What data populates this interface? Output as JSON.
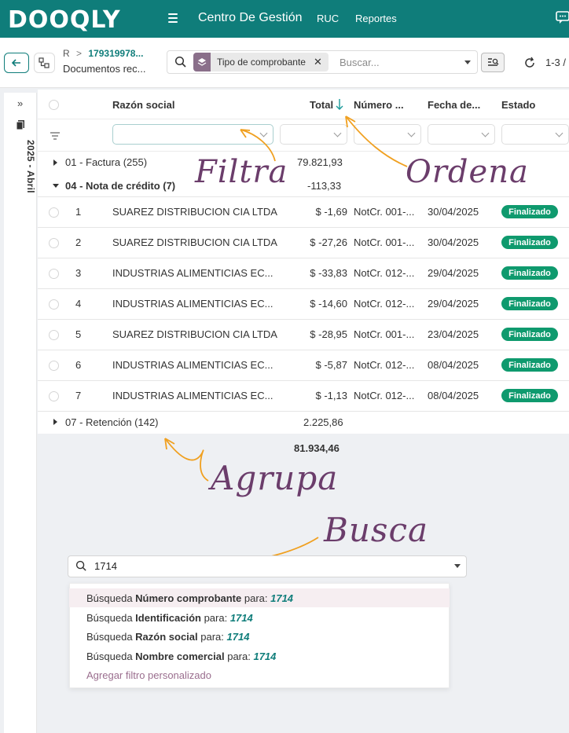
{
  "brand": {
    "logo_text": "DOOQLY",
    "accent": "#0f7d7a"
  },
  "topnav": {
    "title": "Centro De Gestión",
    "links": [
      "RUC",
      "Reportes"
    ]
  },
  "breadcrumb": {
    "prefix": "R",
    "separator": ">",
    "link": "179319978...",
    "current": "Documentos rec..."
  },
  "search": {
    "facet_label": "Tipo de comprobante",
    "placeholder": "Buscar...",
    "pager": "1-3 /"
  },
  "side": {
    "label": "2025 - Abril"
  },
  "columns": {
    "razon": "Razón social",
    "total": "Total",
    "numero": "Número ...",
    "fecha": "Fecha de...",
    "estado": "Estado"
  },
  "groups": [
    {
      "label": "01 - Factura (255)",
      "total": "79.821,93"
    },
    {
      "label": "04 - Nota de crédito (7)",
      "total": "-113,33"
    },
    {
      "label": "07 - Retención (142)",
      "total": "2.225,86"
    }
  ],
  "rows": [
    {
      "n": "1",
      "razon": "SUAREZ DISTRIBUCION CIA LTDA",
      "total": "$ -1,69",
      "numero": "NotCr. 001-...",
      "fecha": "30/04/2025",
      "estado": "Finalizado"
    },
    {
      "n": "2",
      "razon": "SUAREZ DISTRIBUCION CIA LTDA",
      "total": "$ -27,26",
      "numero": "NotCr. 001-...",
      "fecha": "30/04/2025",
      "estado": "Finalizado"
    },
    {
      "n": "3",
      "razon": "INDUSTRIAS ALIMENTICIAS EC...",
      "total": "$ -33,83",
      "numero": "NotCr. 012-...",
      "fecha": "29/04/2025",
      "estado": "Finalizado"
    },
    {
      "n": "4",
      "razon": "INDUSTRIAS ALIMENTICIAS EC...",
      "total": "$ -14,60",
      "numero": "NotCr. 012-...",
      "fecha": "29/04/2025",
      "estado": "Finalizado"
    },
    {
      "n": "5",
      "razon": "SUAREZ DISTRIBUCION CIA LTDA",
      "total": "$ -28,95",
      "numero": "NotCr. 001-...",
      "fecha": "23/04/2025",
      "estado": "Finalizado"
    },
    {
      "n": "6",
      "razon": "INDUSTRIAS ALIMENTICIAS EC...",
      "total": "$ -5,87",
      "numero": "NotCr. 012-...",
      "fecha": "08/04/2025",
      "estado": "Finalizado"
    },
    {
      "n": "7",
      "razon": "INDUSTRIAS ALIMENTICIAS EC...",
      "total": "$ -1,13",
      "numero": "NotCr. 012-...",
      "fecha": "08/04/2025",
      "estado": "Finalizado"
    }
  ],
  "grand_total": "81.934,46",
  "annotations": {
    "filtra": "Filtra",
    "ordena": "Ordena",
    "agrupa": "Agrupa",
    "busca": "Busca"
  },
  "popup": {
    "query": "1714",
    "items": [
      {
        "prefix": "Búsqueda ",
        "field": "Número comprobante",
        "mid": " para: ",
        "value": "1714"
      },
      {
        "prefix": "Búsqueda ",
        "field": "Identificación",
        "mid": " para: ",
        "value": "1714"
      },
      {
        "prefix": "Búsqueda ",
        "field": "Razón social",
        "mid": " para: ",
        "value": "1714"
      },
      {
        "prefix": "Búsqueda ",
        "field": "Nombre comercial",
        "mid": " para: ",
        "value": "1714"
      }
    ],
    "add_filter": "Agregar filtro personalizado"
  }
}
